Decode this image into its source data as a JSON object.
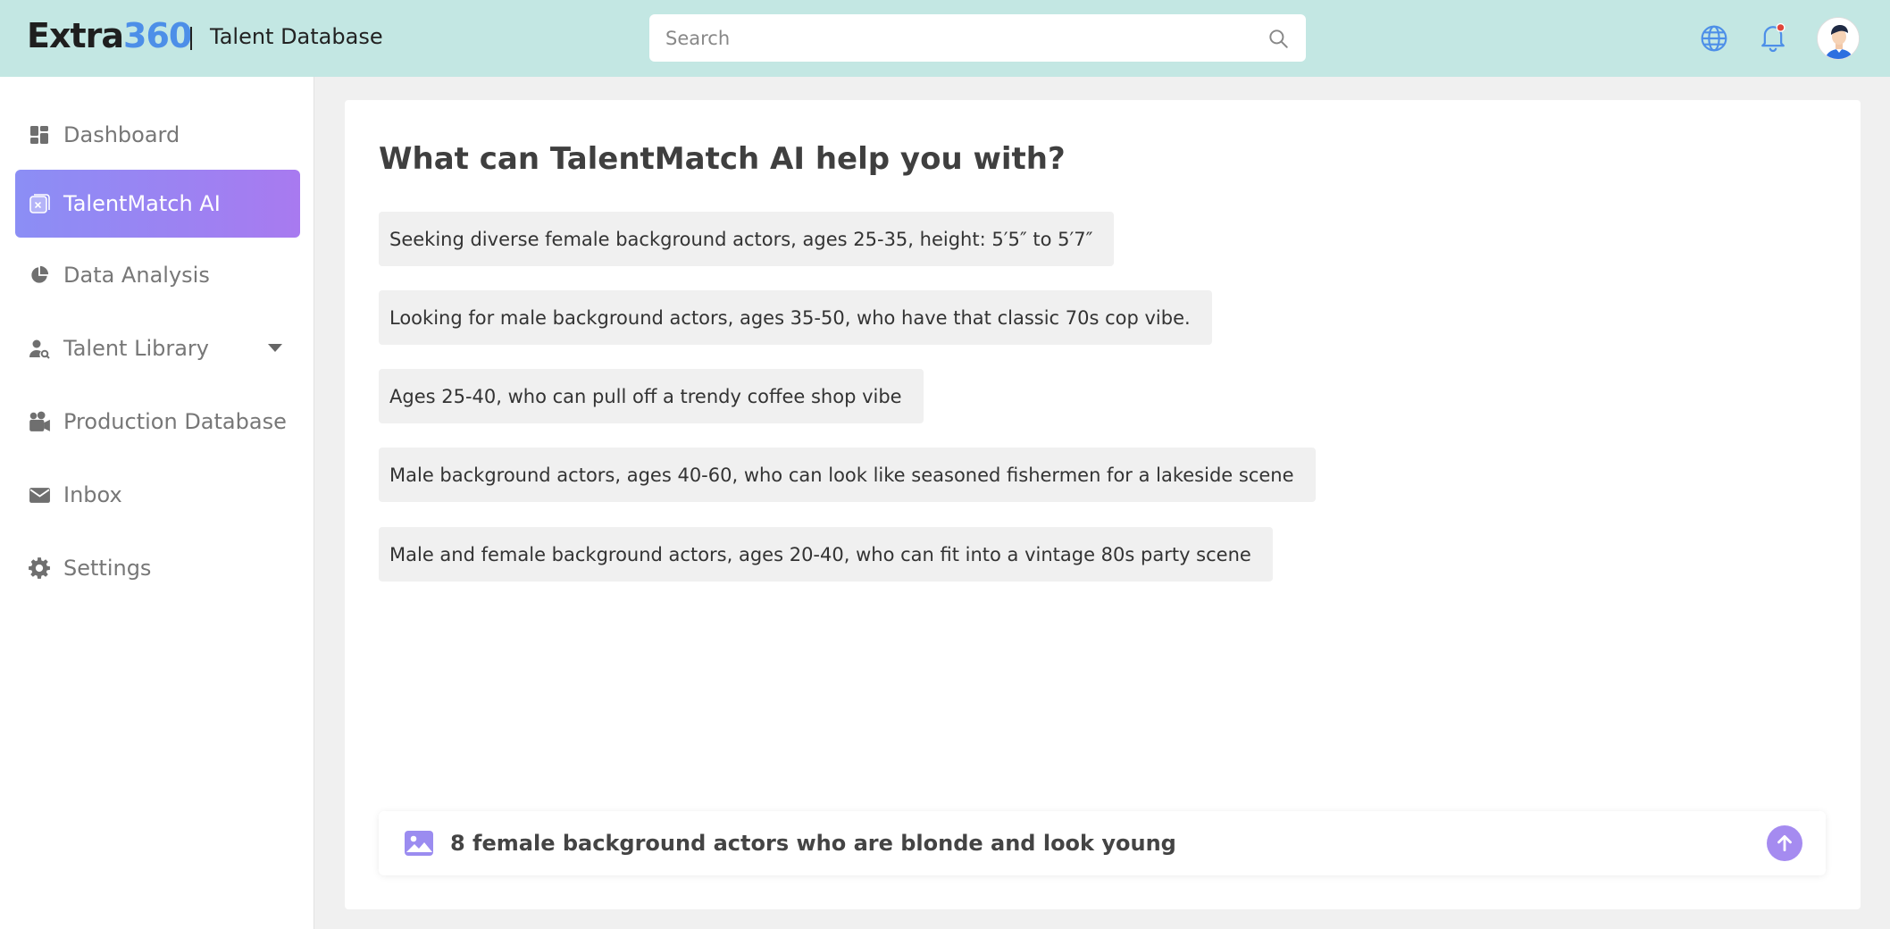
{
  "header": {
    "logo_text": "Extra",
    "logo_number": "360",
    "app_title": "Talent Database",
    "search_placeholder": "Search"
  },
  "icons": {
    "search": "search-icon",
    "language": "globe-icon",
    "notifications": "bell-icon",
    "avatar": "user-avatar"
  },
  "colors": {
    "header_bg": "#c3e7e3",
    "accent_start": "#8b8ef5",
    "accent_end": "#a87af0",
    "logo_blue": "#4d8fe8",
    "notification_dot": "#e0453a"
  },
  "sidebar": {
    "items": [
      {
        "label": "Dashboard",
        "icon": "dashboard-icon"
      },
      {
        "label": "TalentMatch AI",
        "icon": "ai-icon",
        "active": true
      },
      {
        "label": "Data Analysis",
        "icon": "pie-chart-icon"
      },
      {
        "label": "Talent Library",
        "icon": "user-search-icon",
        "has_dropdown": true
      },
      {
        "label": "Production Database",
        "icon": "camera-icon"
      },
      {
        "label": "Inbox",
        "icon": "mail-icon"
      },
      {
        "label": "Settings",
        "icon": "gear-icon"
      }
    ]
  },
  "main": {
    "heading": "What can TalentMatch AI help you with?",
    "suggestions": [
      "Seeking diverse female background actors, ages 25-35, height: 5′5″ to 5′7″",
      "Looking for male background actors, ages 35-50, who have that classic 70s cop vibe.",
      "Ages 25-40, who can pull off a trendy coffee shop vibe",
      "Male background actors, ages 40-60, who can look like seasoned fishermen for a lakeside scene",
      "Male and female background actors, ages 20-40, who can fit into a vintage 80s party scene"
    ],
    "composer": {
      "value": "8 female background actors who are blonde and look young"
    }
  }
}
